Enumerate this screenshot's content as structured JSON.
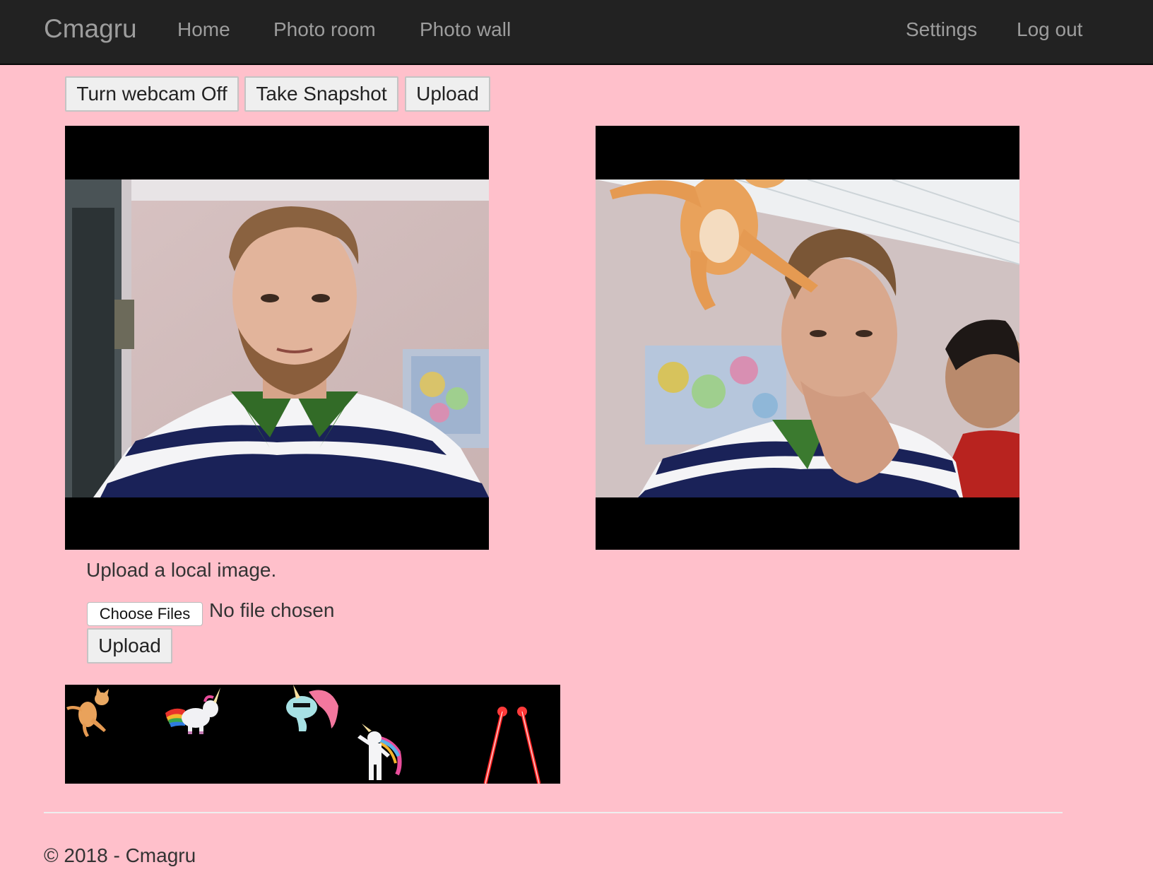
{
  "nav": {
    "brand": "Cmagru",
    "links": [
      "Home",
      "Photo room",
      "Photo wall"
    ],
    "right_links": [
      "Settings",
      "Log out"
    ]
  },
  "controls": {
    "webcam_toggle_label": "Turn webcam Off",
    "snapshot_label": "Take Snapshot",
    "upload_label": "Upload"
  },
  "upload_form": {
    "prompt": "Upload a local image.",
    "choose_files_label": "Choose Files",
    "no_file_text": "No file chosen",
    "submit_label": "Upload"
  },
  "stickers": [
    "cat-sticker",
    "rainbow-unicorn-sticker",
    "unicorn-head-sticker",
    "dabbing-unicorn-sticker",
    "laser-eyes-sticker"
  ],
  "footer": {
    "text": "© 2018 - Cmagru"
  }
}
